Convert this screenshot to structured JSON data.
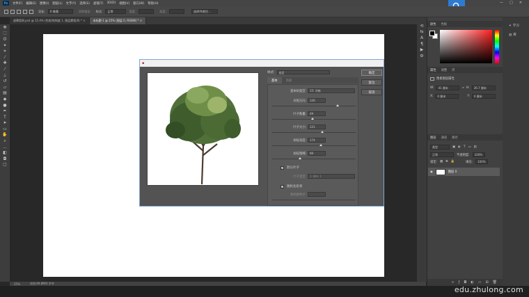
{
  "app": {
    "logo_text": "Ps",
    "brand_color": "#31a8ff",
    "accent": "#2e7ad1"
  },
  "menu": [
    "文件(F)",
    "编辑(E)",
    "图像(I)",
    "图层(L)",
    "文字(Y)",
    "选择(S)",
    "滤镜(T)",
    "3D(D)",
    "视图(V)",
    "窗口(W)",
    "帮助(H)"
  ],
  "options": {
    "feather_label": "羽化:",
    "feather_value": "0 像素",
    "antialias": "消除锯齿",
    "style_label": "样式:",
    "style_value": "正常",
    "width_label": "宽度:",
    "height_label": "高度:",
    "select_mask": "选择并遮住..."
  },
  "window": {
    "minimize": "—",
    "maximize": "□",
    "close": "✕"
  },
  "tabs": [
    {
      "label": "遮罩案例.psd @ 15.4% (色相/饱和度 1, 图层蒙版/8) *",
      "close": "×"
    },
    {
      "label": "未标题-1 @ 25% (图层 0, RGB/8) *",
      "close": "×"
    }
  ],
  "statusbar": {
    "zoom": "25%",
    "doc": "文档:49.8M/0 字节"
  },
  "watermark": "edu.zhulong.com",
  "panels": {
    "color": {
      "tab1": "颜色",
      "tab2": "色板"
    },
    "properties": {
      "tab1": "属性",
      "tab2": "调整",
      "tab3": "库",
      "doc_title": "像素图层属性",
      "w_label": "W:",
      "w_value": "41 厘米",
      "h_label": "H:",
      "h_value": "26.7 厘米",
      "x_label": "X:",
      "x_value": "0 厘米",
      "y_label": "Y:",
      "y_value": "0 厘米"
    },
    "layers": {
      "tab1": "图层",
      "tab2": "通道",
      "tab3": "路径",
      "kind": "类型",
      "blend": "正常",
      "opacity_label": "不透明度:",
      "opacity": "100%",
      "lock_label": "锁定:",
      "fill_label": "填充:",
      "fill": "100%",
      "layer_name": "图层 0"
    },
    "right_icons": [
      {
        "icon": "lightbulb-icon",
        "label": "学习"
      },
      {
        "icon": "library-icon",
        "label": "库"
      }
    ]
  },
  "dialog": {
    "ok": "确定",
    "reset": "复位",
    "cancel": "取消",
    "style_label": "样式:",
    "style_value": "自定",
    "tab_basic": "基本",
    "tab_advanced": "高级",
    "params": [
      {
        "label": "基本树类型:",
        "value": "15: 冷栋",
        "type": "select"
      },
      {
        "label": "光照方向:",
        "value": "126",
        "type": "slider",
        "pos": 0.78
      },
      {
        "label": "叶子数量:",
        "value": "49",
        "type": "slider",
        "pos": 0.48
      },
      {
        "label": "叶子大小:",
        "value": "121",
        "type": "slider",
        "pos": 0.6
      },
      {
        "label": "树枝高度:",
        "value": "174",
        "type": "slider",
        "pos": 0.58
      },
      {
        "label": "树枝粗细:",
        "value": "99",
        "type": "slider",
        "pos": 0.33
      }
    ],
    "default_leaves": "默认叶子",
    "custom_leaves_label": "叶子类型:",
    "custom_leaves_value": "1: 枫叶 1",
    "randomize": "随机化形状",
    "random_seed_label": "随机数种子:"
  }
}
